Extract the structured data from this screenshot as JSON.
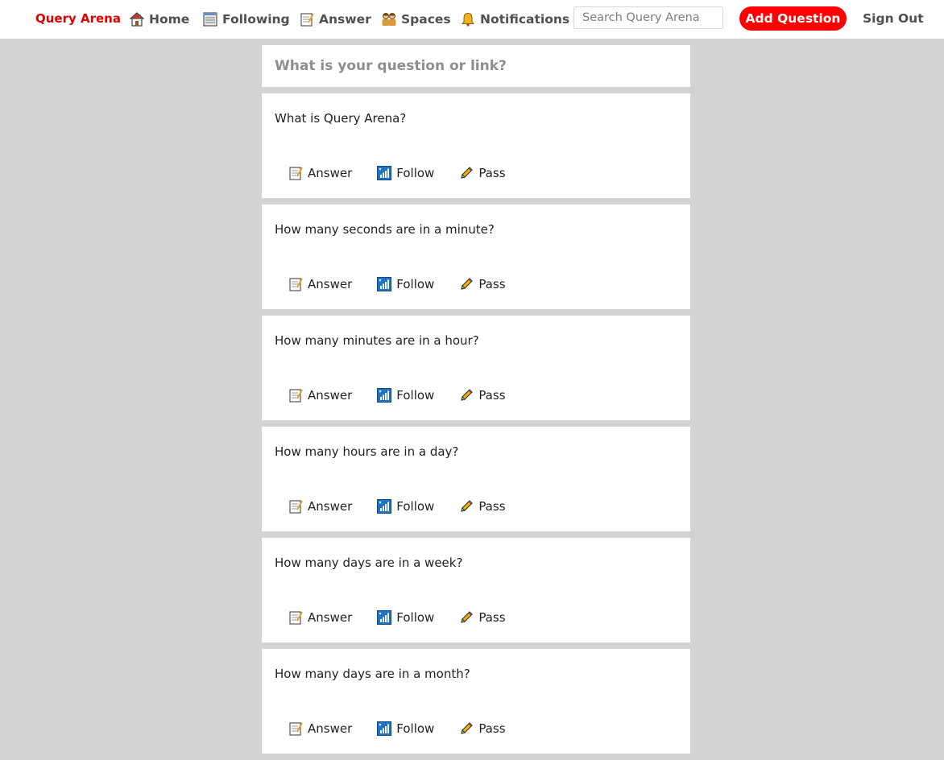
{
  "nav": {
    "brand": "Query Arena",
    "items": [
      {
        "label": "Home",
        "icon": "house-icon"
      },
      {
        "label": "Following",
        "icon": "newspaper-icon"
      },
      {
        "label": "Answer",
        "icon": "memo-icon"
      },
      {
        "label": "Spaces",
        "icon": "people-icon"
      },
      {
        "label": "Notifications",
        "icon": "bell-icon"
      }
    ],
    "search_placeholder": "Search Query Arena",
    "add_question_label": "Add Question",
    "sign_out_label": "Sign Out"
  },
  "ask": {
    "placeholder": "What is your question or link?"
  },
  "actions": {
    "answer": "Answer",
    "follow": "Follow",
    "pass": "Pass"
  },
  "questions": [
    {
      "text": "What is Query Arena?"
    },
    {
      "text": "How many seconds are in a minute?"
    },
    {
      "text": "How many minutes are in a hour?"
    },
    {
      "text": "How many hours are in a day?"
    },
    {
      "text": "How many days are in a week?"
    },
    {
      "text": "How many days are in a month?"
    }
  ],
  "colors": {
    "brand": "#e00000",
    "accent_button": "#fe0000",
    "page_background": "#d3d3d3"
  }
}
